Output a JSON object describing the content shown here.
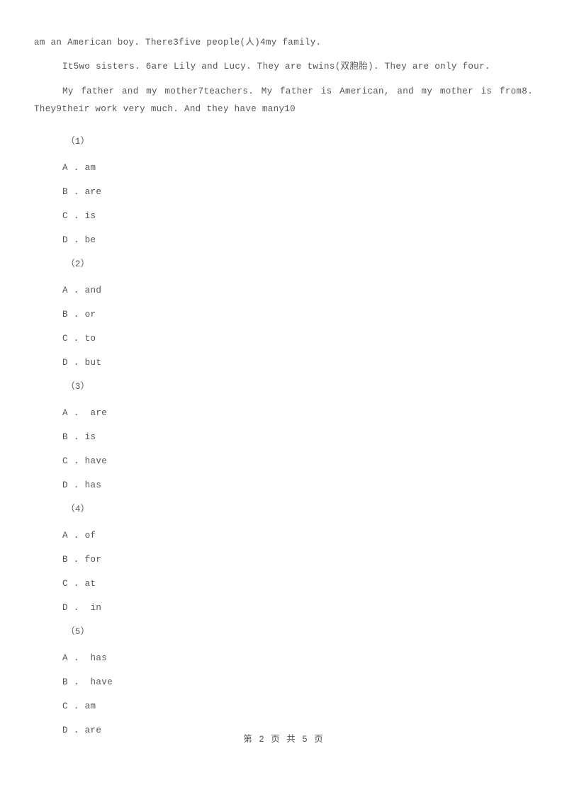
{
  "document": {
    "body_paragraphs": [
      {
        "id": "paragraph-1",
        "indent": false,
        "text": "am an American boy. There3five people(人)4my family."
      },
      {
        "id": "paragraph-2",
        "indent": true,
        "text": "It5wo sisters. 6are Lily and Lucy. They are twins(双胞胎). They are only four."
      },
      {
        "id": "paragraph-3",
        "indent": true,
        "text": "My father and my mother7teachers. My father is American, and my mother is from8. They9their work very much. And they have many10"
      }
    ],
    "questions": [
      {
        "number": "（1）",
        "options": [
          "A . am",
          "B . are",
          "C . is",
          "D . be"
        ]
      },
      {
        "number": "（2）",
        "options": [
          "A . and",
          "B . or",
          "C . to",
          "D . but"
        ]
      },
      {
        "number": "（3）",
        "options": [
          "A .  are",
          "B . is",
          "C . have",
          "D . has"
        ]
      },
      {
        "number": "（4）",
        "options": [
          "A . of",
          "B . for",
          "C . at",
          "D .  in"
        ]
      },
      {
        "number": "（5）",
        "options": [
          "A .  has",
          "B .  have",
          "C . am",
          "D . are"
        ]
      }
    ],
    "footer": {
      "page_label": "第 2 页 共 5 页",
      "current_page": 2,
      "total_pages": 5
    },
    "colors": {
      "text": "#555555",
      "background": "#ffffff"
    }
  }
}
